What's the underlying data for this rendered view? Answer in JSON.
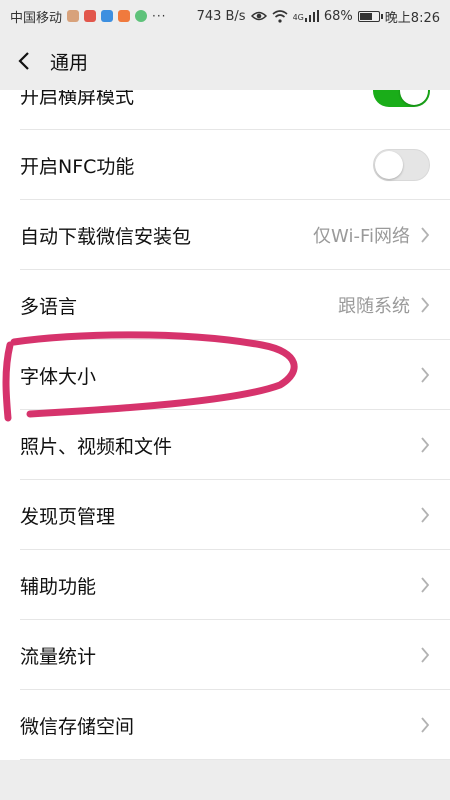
{
  "status_bar": {
    "carrier": "中国移动",
    "more": "···",
    "network_speed": "743 B/s",
    "network_type": "4G",
    "battery": "68%",
    "battery_level": 0.68,
    "time": "晚上8:26",
    "icons": [
      "eye-icon",
      "wifi-icon",
      "signal-icon",
      "battery-icon"
    ]
  },
  "nav": {
    "title": "通用",
    "back_icon": "chevron-left-icon"
  },
  "settings": {
    "landscape": {
      "label": "开启横屏模式",
      "toggle": "on"
    },
    "nfc": {
      "label": "开启NFC功能",
      "toggle": "off"
    },
    "auto_download": {
      "label": "自动下载微信安装包",
      "value": "仅Wi-Fi网络"
    },
    "language": {
      "label": "多语言",
      "value": "跟随系统"
    },
    "font_size": {
      "label": "字体大小"
    },
    "media": {
      "label": "照片、视频和文件"
    },
    "discover": {
      "label": "发现页管理"
    },
    "accessibility": {
      "label": "辅助功能"
    },
    "traffic": {
      "label": "流量统计"
    },
    "storage": {
      "label": "微信存储空间"
    }
  },
  "colors": {
    "toggle_on": "#1aad19",
    "toggle_off": "#e5e5e5",
    "annotation": "#d6336c",
    "page_bg": "#ededed"
  }
}
